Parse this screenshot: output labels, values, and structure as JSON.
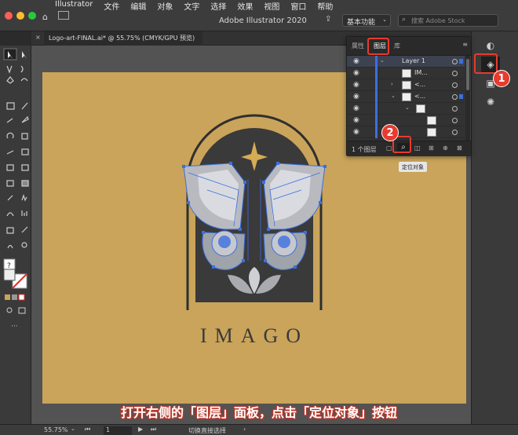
{
  "menubar": {
    "items": [
      "Illustrator",
      "文件",
      "编辑",
      "对象",
      "文字",
      "选择",
      "效果",
      "视图",
      "窗口",
      "帮助"
    ]
  },
  "app": {
    "title": "Adobe Illustrator 2020",
    "workspace": "基本功能",
    "search_placeholder": "搜索 Adobe Stock"
  },
  "document": {
    "tab_label": "Logo-art-FINAL.ai* @ 55.75% (CMYK/GPU 预览)"
  },
  "panel": {
    "tabs": [
      "属性",
      "图层",
      "库"
    ],
    "active_tab": "图层",
    "layer_count": "1 个图层",
    "rows": [
      {
        "name": "Layer 1"
      },
      {
        "name": "IM..."
      },
      {
        "name": "<..."
      },
      {
        "name": "<..."
      },
      {
        "name": ""
      },
      {
        "name": ""
      },
      {
        "name": ""
      }
    ],
    "tooltip": "定位对象"
  },
  "artwork": {
    "wordmark": "IMAGO"
  },
  "callouts": {
    "badge1": "1",
    "badge2": "2",
    "caption": "打开右侧的「图层」面板，点击「定位对象」按钮"
  },
  "status": {
    "zoom": "55.75%",
    "artboard": "1",
    "tool": "切换直接选择"
  },
  "colors": {
    "artboard": "#c9a45a",
    "arch": "#3a3a3a",
    "selection": "#3b6fe0",
    "callout": "#e63b2e"
  }
}
